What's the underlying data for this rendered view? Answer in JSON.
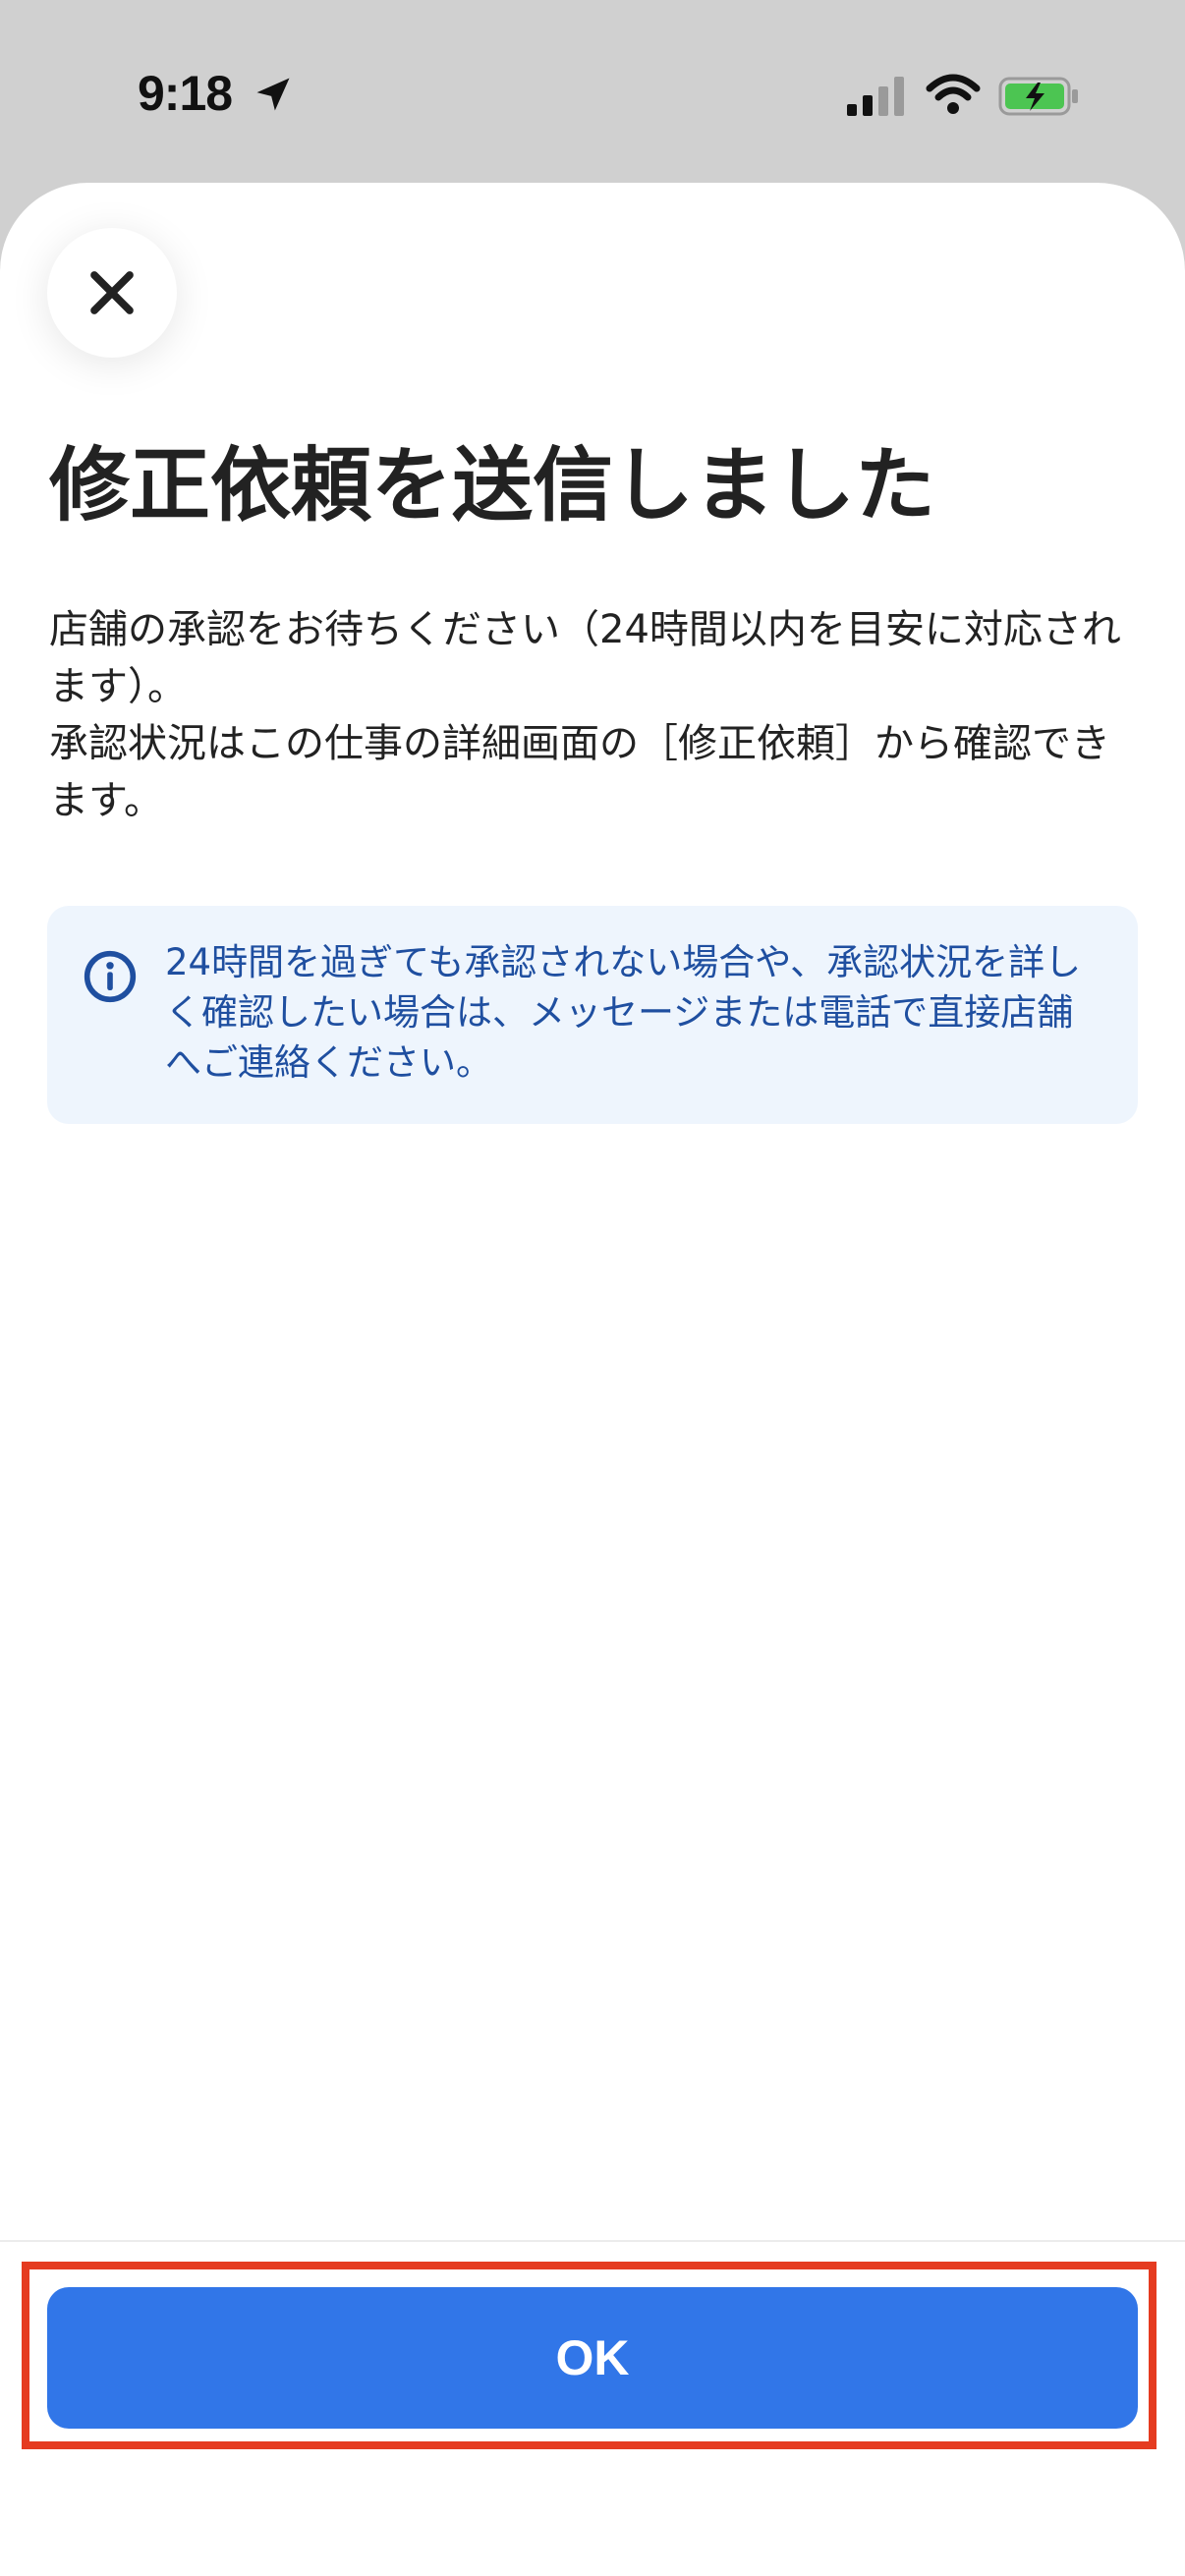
{
  "status_bar": {
    "time": "9:18",
    "icons": [
      "location-arrow-icon",
      "cellular-signal-icon",
      "wifi-icon",
      "battery-charging-icon"
    ]
  },
  "modal": {
    "close_icon": "close-icon",
    "title": "修正依頼を送信しました",
    "body_lines": [
      "店舗の承認をお待ちください（24時間以内を目安に対応されます）。",
      "承認状況はこの仕事の詳細画面の［修正依頼］から確認できます。"
    ],
    "info": {
      "icon": "info-icon",
      "text": "24時間を過ぎても承認されない場合や、承認状況を詳しく確認したい場合は、メッセージまたは電話で直接店舗へご連絡ください。"
    },
    "ok_label": "OK"
  },
  "colors": {
    "accent": "#3176e8",
    "info_background": "#eef5fd",
    "info_text": "#1f4fa0",
    "highlight": "#e53b20",
    "status_background": "#d0d0d0"
  }
}
